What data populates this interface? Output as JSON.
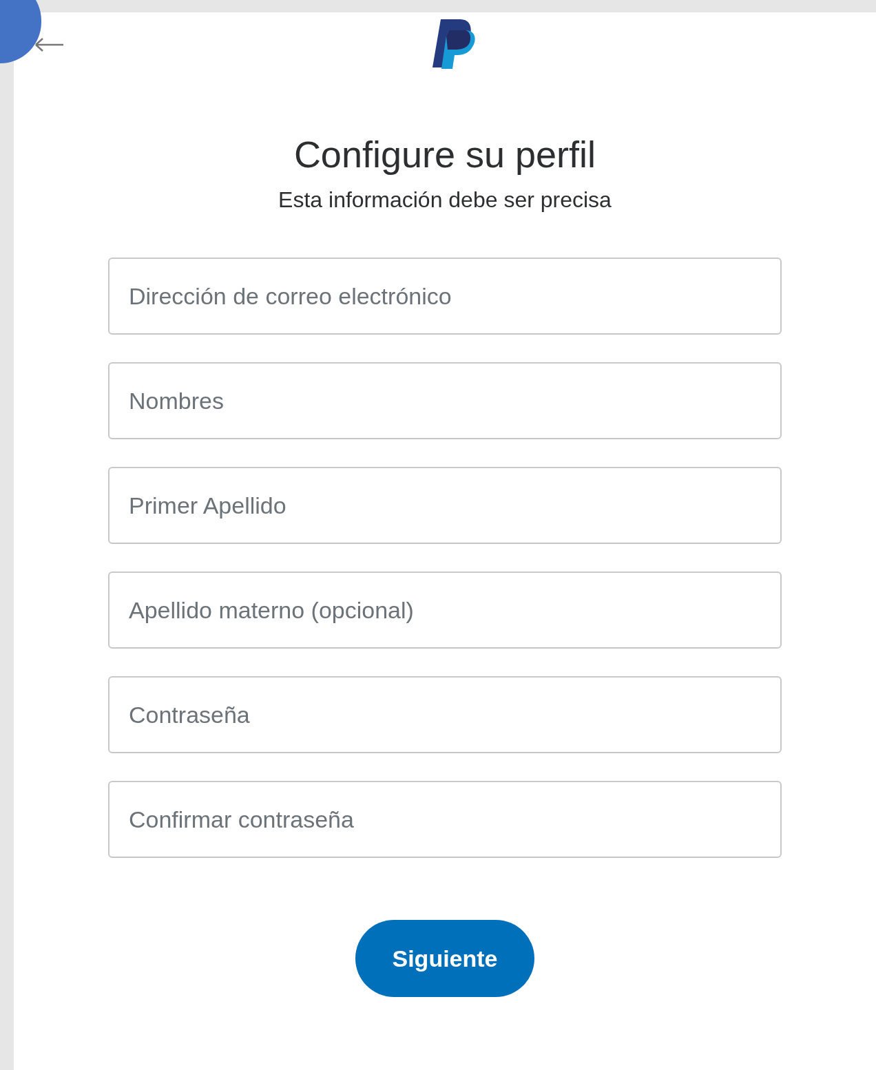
{
  "title": "Configure su perfil",
  "subtitle": "Esta información debe ser precisa",
  "fields": [
    {
      "placeholder": "Dirección de correo electrónico"
    },
    {
      "placeholder": "Nombres"
    },
    {
      "placeholder": "Primer Apellido"
    },
    {
      "placeholder": "Apellido materno (opcional)"
    },
    {
      "placeholder": "Contraseña"
    },
    {
      "placeholder": "Confirmar contraseña"
    }
  ],
  "next_button": "Siguiente"
}
